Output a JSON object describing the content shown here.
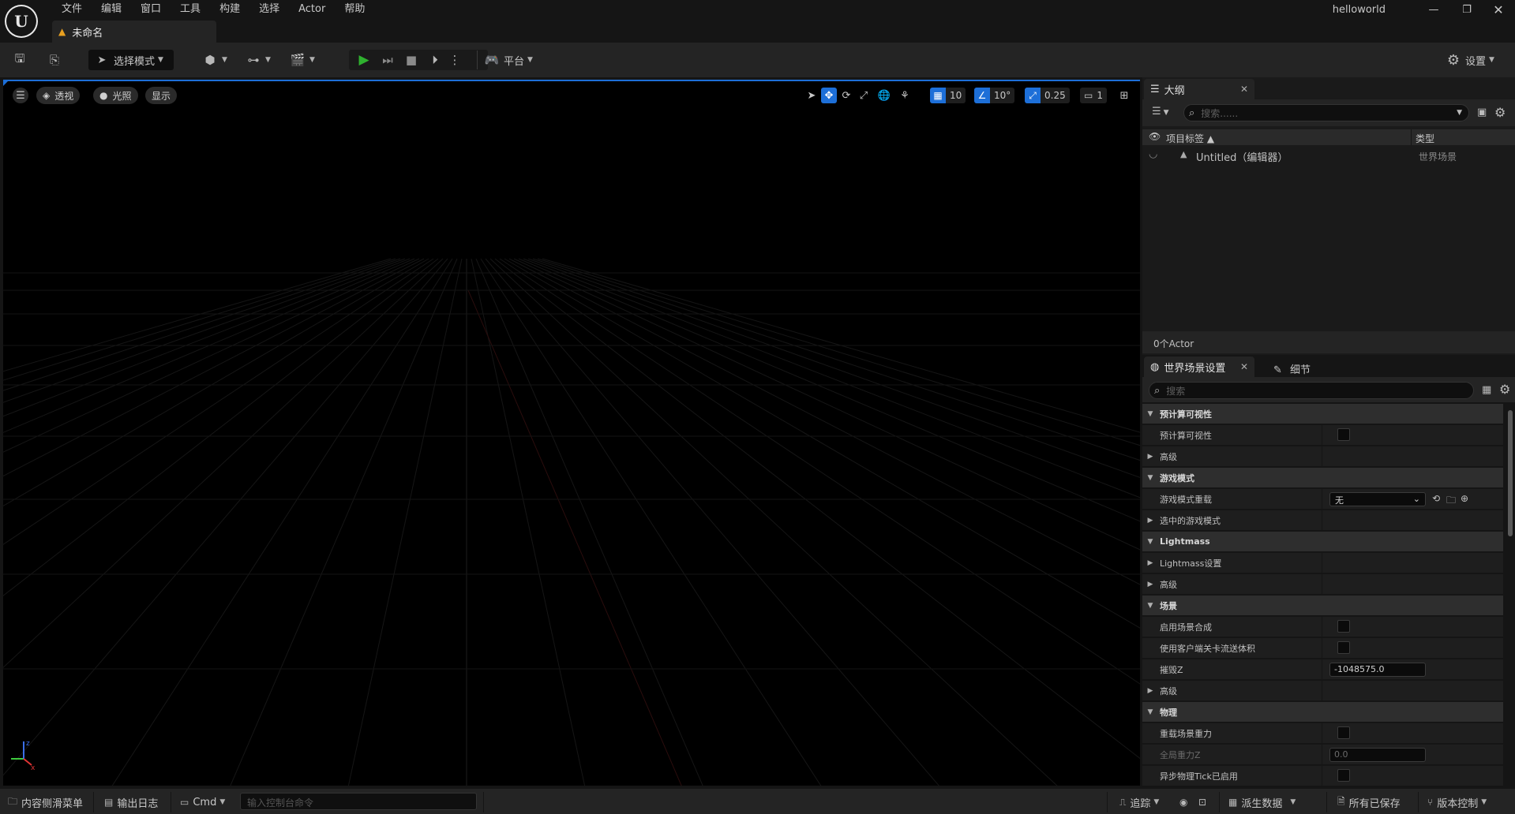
{
  "titlebar": {
    "logo_letter": "U",
    "menus": [
      "文件",
      "编辑",
      "窗口",
      "工具",
      "构建",
      "选择",
      "Actor",
      "帮助"
    ],
    "document_tab": "未命名",
    "project_name": "helloworld"
  },
  "toolbar": {
    "mode_select": "选择模式",
    "platform_label": "平台",
    "settings_label": "设置"
  },
  "viewport": {
    "perspective_label": "透视",
    "lighting_label": "光照",
    "show_label": "显示",
    "grid_snap_value": "10",
    "rotation_snap_value": "10°",
    "scale_snap_value": "0.25",
    "camera_speed_value": "1",
    "accent_color": "#1d6fd8"
  },
  "outliner": {
    "tab_label": "大纲",
    "search_placeholder": "搜索......",
    "col_label": "项目标签 ▲",
    "col_type": "类型",
    "rows": [
      {
        "label": "Untitled（编辑器）",
        "type": "世界场景"
      }
    ],
    "footer": "0个Actor"
  },
  "details": {
    "tab_world_settings": "世界场景设置",
    "tab_details": "细节",
    "search_placeholder": "搜索",
    "rows": [
      {
        "kind": "cat",
        "expanded": true,
        "name": "预计算可视性"
      },
      {
        "kind": "item",
        "name": "预计算可视性",
        "control": "checkbox"
      },
      {
        "kind": "item",
        "expandable": true,
        "name": "高级"
      },
      {
        "kind": "cat",
        "expanded": true,
        "name": "游戏模式"
      },
      {
        "kind": "item",
        "name": "游戏模式重载",
        "control": "dropdown",
        "value": "无"
      },
      {
        "kind": "item",
        "expandable": true,
        "name": "选中的游戏模式"
      },
      {
        "kind": "cat",
        "expanded": true,
        "name": "Lightmass"
      },
      {
        "kind": "item",
        "expandable": true,
        "name": "Lightmass设置"
      },
      {
        "kind": "item",
        "expandable": true,
        "name": "高级"
      },
      {
        "kind": "cat",
        "expanded": true,
        "name": "场景"
      },
      {
        "kind": "item",
        "name": "启用场景合成",
        "control": "checkbox"
      },
      {
        "kind": "item",
        "name": "使用客户端关卡流送体积",
        "control": "checkbox"
      },
      {
        "kind": "item",
        "name": "摧毁Z",
        "control": "number",
        "value": "-1048575.0"
      },
      {
        "kind": "item",
        "expandable": true,
        "name": "高级"
      },
      {
        "kind": "cat",
        "expanded": true,
        "name": "物理"
      },
      {
        "kind": "item",
        "name": "重载场景重力",
        "control": "checkbox"
      },
      {
        "kind": "item",
        "name": "全局重力Z",
        "control": "number",
        "value": "0.0",
        "disabled": true
      },
      {
        "kind": "item",
        "name": "异步物理Tick已启用",
        "control": "checkbox"
      }
    ]
  },
  "statusbar": {
    "content_drawer": "内容侧滑菜单",
    "output_log": "输出日志",
    "cmd_label": "Cmd",
    "console_placeholder": "输入控制台命令",
    "trace_label": "追踪",
    "derived_data": "派生数据",
    "all_saved": "所有已保存",
    "source_control": "版本控制"
  }
}
